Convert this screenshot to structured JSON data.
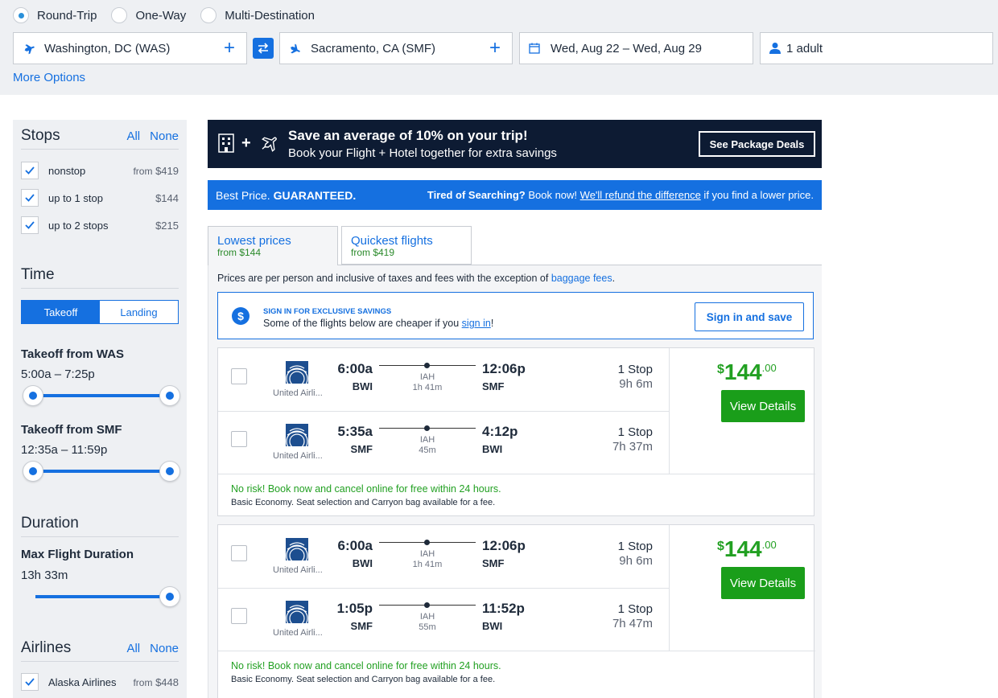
{
  "trip_types": [
    {
      "label": "Round-Trip",
      "selected": true
    },
    {
      "label": "One-Way",
      "selected": false
    },
    {
      "label": "Multi-Destination",
      "selected": false
    }
  ],
  "search": {
    "origin": "Washington, DC (WAS)",
    "destination": "Sacramento, CA (SMF)",
    "dates": "Wed, Aug 22 – Wed, Aug 29",
    "travelers": "1 adult",
    "more_options": "More Options"
  },
  "sidebar": {
    "stops": {
      "title": "Stops",
      "all": "All",
      "none": "None",
      "options": [
        {
          "label": "nonstop",
          "price_prefix": "from",
          "price": "$419",
          "checked": true
        },
        {
          "label": "up to 1 stop",
          "price_prefix": "",
          "price": "$144",
          "checked": true
        },
        {
          "label": "up to 2 stops",
          "price_prefix": "",
          "price": "$215",
          "checked": true
        }
      ]
    },
    "time": {
      "title": "Time",
      "toggle": [
        "Takeoff",
        "Landing"
      ],
      "active_toggle": "Takeoff",
      "groups": [
        {
          "label": "Takeoff from WAS",
          "range": "5:00a  –  7:25p"
        },
        {
          "label": "Takeoff from SMF",
          "range": "12:35a  –  11:59p"
        }
      ]
    },
    "duration": {
      "title": "Duration",
      "label": "Max Flight Duration",
      "value": "13h 33m"
    },
    "airlines": {
      "title": "Airlines",
      "all": "All",
      "none": "None",
      "options": [
        {
          "label": "Alaska Airlines",
          "price_prefix": "from",
          "price": "$448",
          "checked": true
        }
      ]
    }
  },
  "promo": {
    "headline": "Save an average of 10% on your trip!",
    "subline": "Book your Flight + Hotel together for extra savings",
    "button": "See Package Deals"
  },
  "guarantee": {
    "left_plain": "Best Price. ",
    "left_bold": "GUARANTEED.",
    "right_bold": "Tired of Searching?",
    "right_plain": " Book now! ",
    "right_link": "We'll refund the difference",
    "right_tail": " if you find a lower price."
  },
  "tabs": [
    {
      "label": "Lowest prices",
      "sub": "from $144",
      "active": true
    },
    {
      "label": "Quickest flights",
      "sub": "from $419",
      "active": false
    }
  ],
  "note": {
    "text": "Prices are per person and inclusive of taxes and fees with the exception of ",
    "link": "baggage fees",
    "tail": "."
  },
  "signin": {
    "heading": "SIGN IN FOR EXCLUSIVE SAVINGS",
    "text": "Some of the flights below are cheaper if you ",
    "link": "sign in",
    "tail": "!",
    "button": "Sign in and save"
  },
  "results": [
    {
      "legs": [
        {
          "airline": "United Airli...",
          "depart_time": "6:00a",
          "depart_airport": "BWI",
          "via": "IAH",
          "layover": "1h 41m",
          "arrive_time": "12:06p",
          "arrive_airport": "SMF",
          "stops": "1 Stop",
          "duration": "9h 6m"
        },
        {
          "airline": "United Airli...",
          "depart_time": "5:35a",
          "depart_airport": "SMF",
          "via": "IAH",
          "layover": "45m",
          "arrive_time": "4:12p",
          "arrive_airport": "BWI",
          "stops": "1 Stop",
          "duration": "7h 37m"
        }
      ],
      "price_symbol": "$",
      "price_whole": "144",
      "price_cents": ".00",
      "button": "View Details",
      "cancel_note": "No risk! Book now and cancel online for free within 24 hours.",
      "fare_note": "Basic Economy. Seat selection and Carryon bag available for a fee."
    },
    {
      "legs": [
        {
          "airline": "United Airli...",
          "depart_time": "6:00a",
          "depart_airport": "BWI",
          "via": "IAH",
          "layover": "1h 41m",
          "arrive_time": "12:06p",
          "arrive_airport": "SMF",
          "stops": "1 Stop",
          "duration": "9h 6m"
        },
        {
          "airline": "United Airli...",
          "depart_time": "1:05p",
          "depart_airport": "SMF",
          "via": "IAH",
          "layover": "55m",
          "arrive_time": "11:52p",
          "arrive_airport": "BWI",
          "stops": "1 Stop",
          "duration": "7h 47m"
        }
      ],
      "price_symbol": "$",
      "price_whole": "144",
      "price_cents": ".00",
      "button": "View Details",
      "cancel_note": "No risk! Book now and cancel online for free within 24 hours.",
      "fare_note": "Basic Economy. Seat selection and Carryon bag available for a fee."
    }
  ],
  "colors": {
    "accent": "#1570e0",
    "price_green": "#22a022",
    "promo_bg": "#0d1b33"
  }
}
